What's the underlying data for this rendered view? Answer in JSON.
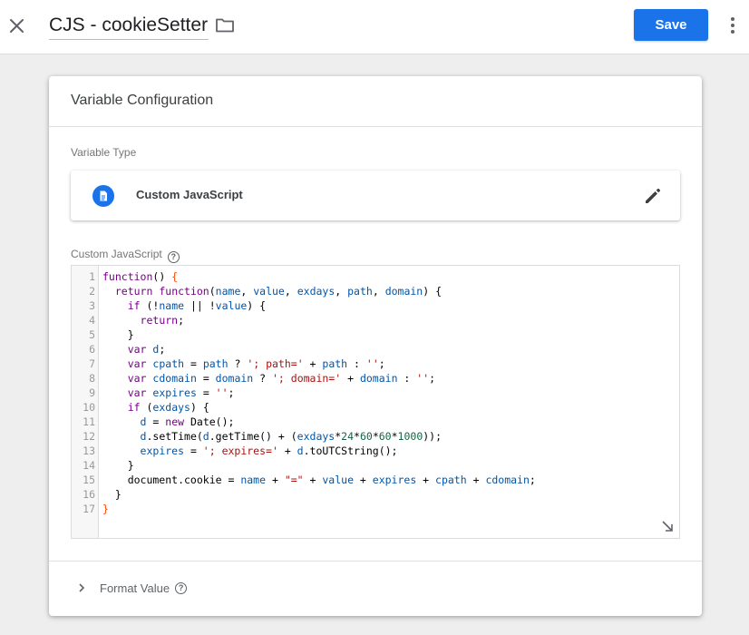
{
  "header": {
    "title": "CJS - cookieSetter",
    "save_label": "Save"
  },
  "card": {
    "title": "Variable Configuration",
    "variable_type_label": "Variable Type",
    "variable_type_value": "Custom JavaScript",
    "custom_js_label": "Custom JavaScript",
    "format_value_label": "Format Value"
  },
  "editor": {
    "line_numbers": [
      "1",
      "2",
      "3",
      "4",
      "5",
      "6",
      "7",
      "8",
      "9",
      "10",
      "11",
      "12",
      "13",
      "14",
      "15",
      "16",
      "17"
    ],
    "lines": [
      "function() {",
      "  return function(name, value, exdays, path, domain) {",
      "    if (!name || !value) {",
      "      return;",
      "    }",
      "    var d;",
      "    var cpath = path ? '; path=' + path : '';",
      "    var cdomain = domain ? '; domain=' + domain : '';",
      "    var expires = '';",
      "    if (exdays) {",
      "      d = new Date();",
      "      d.setTime(d.getTime() + (exdays*24*60*60*1000));",
      "      expires = '; expires=' + d.toUTCString();",
      "    }",
      "    document.cookie = name + \"=\" + value + expires + cpath + cdomain;",
      "  }",
      "}"
    ]
  },
  "icons": {
    "close": "close-icon",
    "folder": "folder-icon",
    "more": "more-vert-icon",
    "variable_type": "document-icon",
    "edit": "pencil-icon",
    "help": "help-icon",
    "resize": "resize-icon",
    "chevron": "chevron-right-icon"
  },
  "colors": {
    "accent": "#1a73e8",
    "background": "#eeeeee",
    "keyword": "#770088",
    "variable_def": "#0000ff",
    "variable": "#0055aa",
    "string": "#aa1111",
    "number": "#116644",
    "bracket": "#ff4400"
  }
}
